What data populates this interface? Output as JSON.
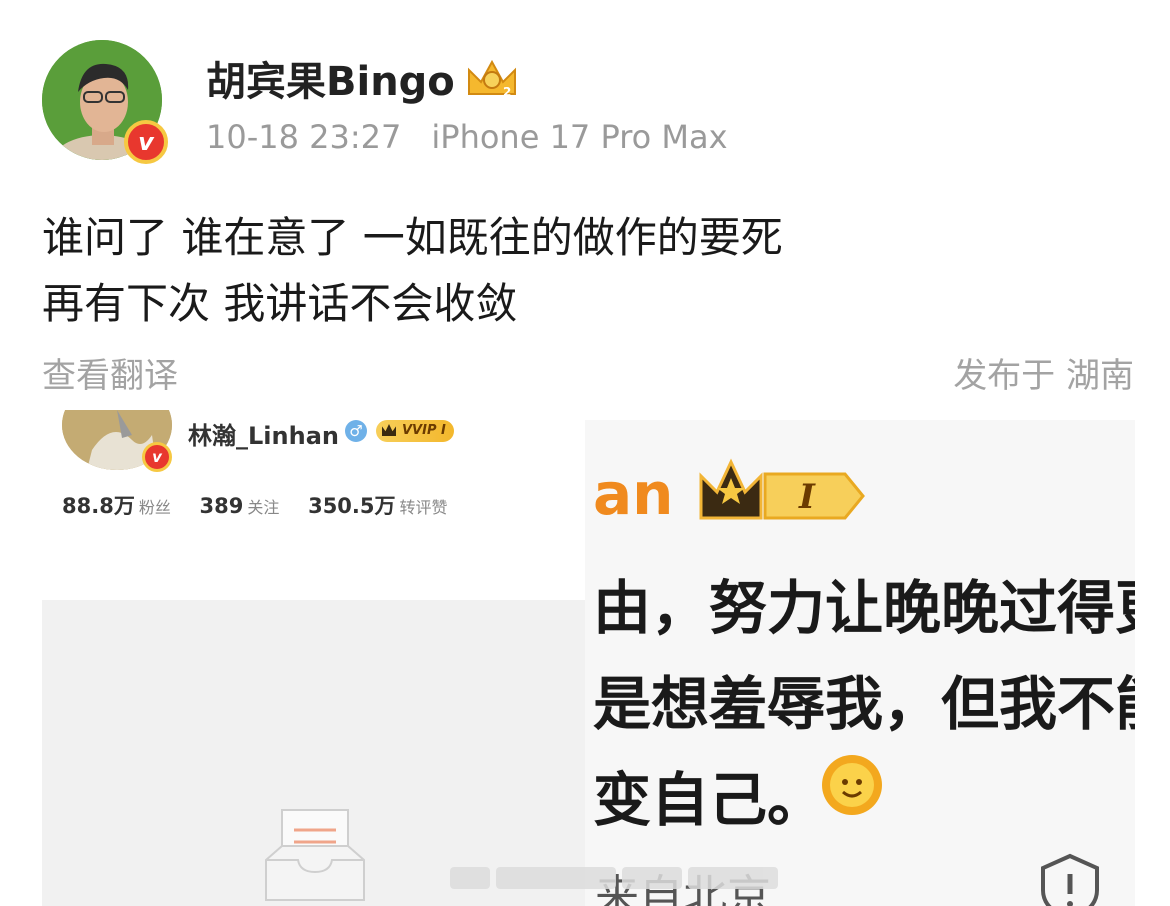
{
  "post": {
    "username": "胡宾果Bingo",
    "timestamp": "10-18 23:27",
    "device": "iPhone 17 Pro Max",
    "text_lines": [
      "谁问了 谁在意了 一如既往的做作的要死",
      "再有下次 我讲话不会收敛"
    ],
    "translate_label": "查看翻译",
    "location": "发布于 湖南"
  },
  "left_screenshot": {
    "username": "林瀚_Linhan",
    "vip_label": "VVIP I",
    "stats": [
      {
        "value": "88.8万",
        "label": "粉丝"
      },
      {
        "value": "389",
        "label": "关注"
      },
      {
        "value": "350.5万",
        "label": "转评赞"
      }
    ]
  },
  "right_screenshot": {
    "name_fragment": "an",
    "vip_level": "I",
    "text_lines": [
      "由，努力让晚晚过得更",
      "是想羞辱我，但我不能",
      "变自己。"
    ],
    "footer_fragment": "来自北京"
  },
  "icons": {
    "verified": "v-badge-icon",
    "crown": "crown-icon",
    "sun_emoji": "sun-emoji-icon",
    "warning": "warning-shield-icon",
    "empty": "empty-box-icon"
  },
  "colors": {
    "verified_red": "#e8372e",
    "gold": "#f6c842",
    "meta_gray": "#9a9a9a",
    "name_orange": "#f08a1e"
  }
}
